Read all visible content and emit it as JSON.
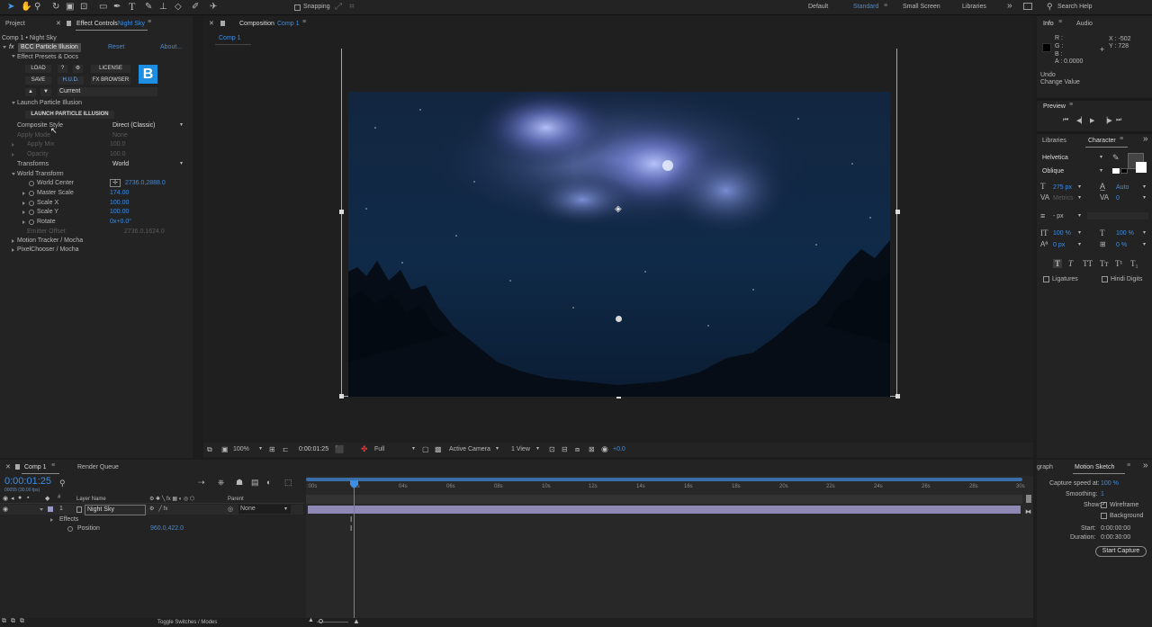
{
  "toolbar": {
    "snapping_label": "Snapping",
    "workspaces": [
      "Default",
      "Standard",
      "Small Screen",
      "Libraries"
    ],
    "search_placeholder": "Search Help"
  },
  "left_panel": {
    "tab_project": "Project",
    "tab_effect_controls": "Effect Controls",
    "tab_layer": "Night Sky",
    "breadcrumb": "Comp 1 • Night Sky",
    "effect": {
      "fx": "fx",
      "name": "BCC Particle Illusion",
      "reset": "Reset",
      "about": "About...",
      "presets_group": "Effect Presets & Docs",
      "btn_load": "LOAD",
      "btn_help": "?",
      "btn_gear": "⚙",
      "btn_license": "LICENSE",
      "btn_save": "SAVE",
      "btn_hud": "H.U.D.",
      "btn_fxbrowser": "FX BROWSER",
      "logo": "B",
      "current_label": "Current",
      "launch_group": "Launch Particle Illusion",
      "btn_launch": "LAUNCH PARTICLE ILLUSION",
      "composite_style_label": "Composite Style",
      "composite_style_value": "Direct (Classic)",
      "apply_mode_label": "Apply Mode",
      "apply_mode_value": "None",
      "apply_mix_label": "Apply Mix",
      "apply_mix_value": "100.0",
      "opacity_label": "Opacity",
      "opacity_value": "100.0",
      "transforms_label": "Transforms",
      "transforms_value": "World",
      "world_transform_group": "World Transform",
      "world_center_label": "World Center",
      "world_center_value": "2736.0,2888.0",
      "master_scale_label": "Master Scale",
      "master_scale_value": "174.00",
      "scale_x_label": "Scale X",
      "scale_x_value": "100.00",
      "scale_y_label": "Scale Y",
      "scale_y_value": "100.00",
      "rotate_label": "Rotate",
      "rotate_value": "0x+0.0°",
      "emitter_offset_label": "Emitter Offset",
      "emitter_offset_value": "2736.0,1624.0",
      "motion_tracker_group": "Motion Tracker / Mocha",
      "pixel_chooser_group": "PixelChooser / Mocha"
    }
  },
  "composition": {
    "tab_label": "Composition",
    "tab_comp": "Comp 1",
    "sub_tab": "Comp 1",
    "footer": {
      "zoom": "100%",
      "timecode": "0:00:01:25",
      "resolution": "Full",
      "camera": "Active Camera",
      "views": "1 View",
      "exposure": "+0.0"
    }
  },
  "right_panel": {
    "tab_info": "Info",
    "tab_audio": "Audio",
    "r_label": "R :",
    "g_label": "G :",
    "b_label": "B :",
    "a_label": "A :",
    "a_value": "0.0000",
    "x_coord": "X : -502",
    "y_coord": "Y : 728",
    "undo_label": "Undo",
    "undo_value": "Change Value",
    "preview_title": "Preview",
    "tab_libraries": "Libraries",
    "tab_character": "Character",
    "font_family": "Helvetica",
    "font_style": "Oblique",
    "font_size": "275 px",
    "leading": "Auto",
    "kerning": "Metrics",
    "tracking": "0",
    "stroke_width": "- px",
    "vert_scale": "100 %",
    "horiz_scale": "100 %",
    "baseline": "0 px",
    "tsume": "0 %",
    "ligatures": "Ligatures",
    "hindi_digits": "Hindi Digits",
    "text_style_buttons": [
      "T",
      "T",
      "TT",
      "Tт",
      "T¹",
      "T₁"
    ]
  },
  "timeline": {
    "tab_comp": "Comp 1",
    "tab_render": "Render Queue",
    "timecode": "0:00:01:25",
    "frame_info": "00055 (30.00 fps)",
    "col_layer_name": "Layer Name",
    "col_parent": "Parent",
    "layer_number": "1",
    "layer_name": "Night Sky",
    "layer_parent": "None",
    "effects_label": "Effects",
    "position_label": "Position",
    "position_value": "960.0,422.0",
    "ruler_ticks": [
      ":00s",
      "02s",
      "04s",
      "06s",
      "08s",
      "10s",
      "12s",
      "14s",
      "16s",
      "18s",
      "20s",
      "22s",
      "24s",
      "26s",
      "28s",
      "30s"
    ],
    "toggle_label": "Toggle Switches / Modes",
    "playhead_seconds": 1.83,
    "duration_seconds": 30
  },
  "motion_sketch": {
    "tab_graph": "graph",
    "tab_title": "Motion Sketch",
    "capture_speed_label": "Capture speed at:",
    "capture_speed_value": "100 %",
    "smoothing_label": "Smoothing:",
    "smoothing_value": "1",
    "show_label": "Show:",
    "wireframe_label": "Wireframe",
    "wireframe_checked": true,
    "background_label": "Background",
    "background_checked": false,
    "start_label": "Start:",
    "start_value": "0:00:00:00",
    "duration_label": "Duration:",
    "duration_value": "0:00:30:00",
    "start_capture": "Start Capture"
  },
  "colors": {
    "accent": "#3d8ee5",
    "panel": "#232323",
    "background": "#1d1d1d",
    "layer_bar": "#8d89b4"
  }
}
